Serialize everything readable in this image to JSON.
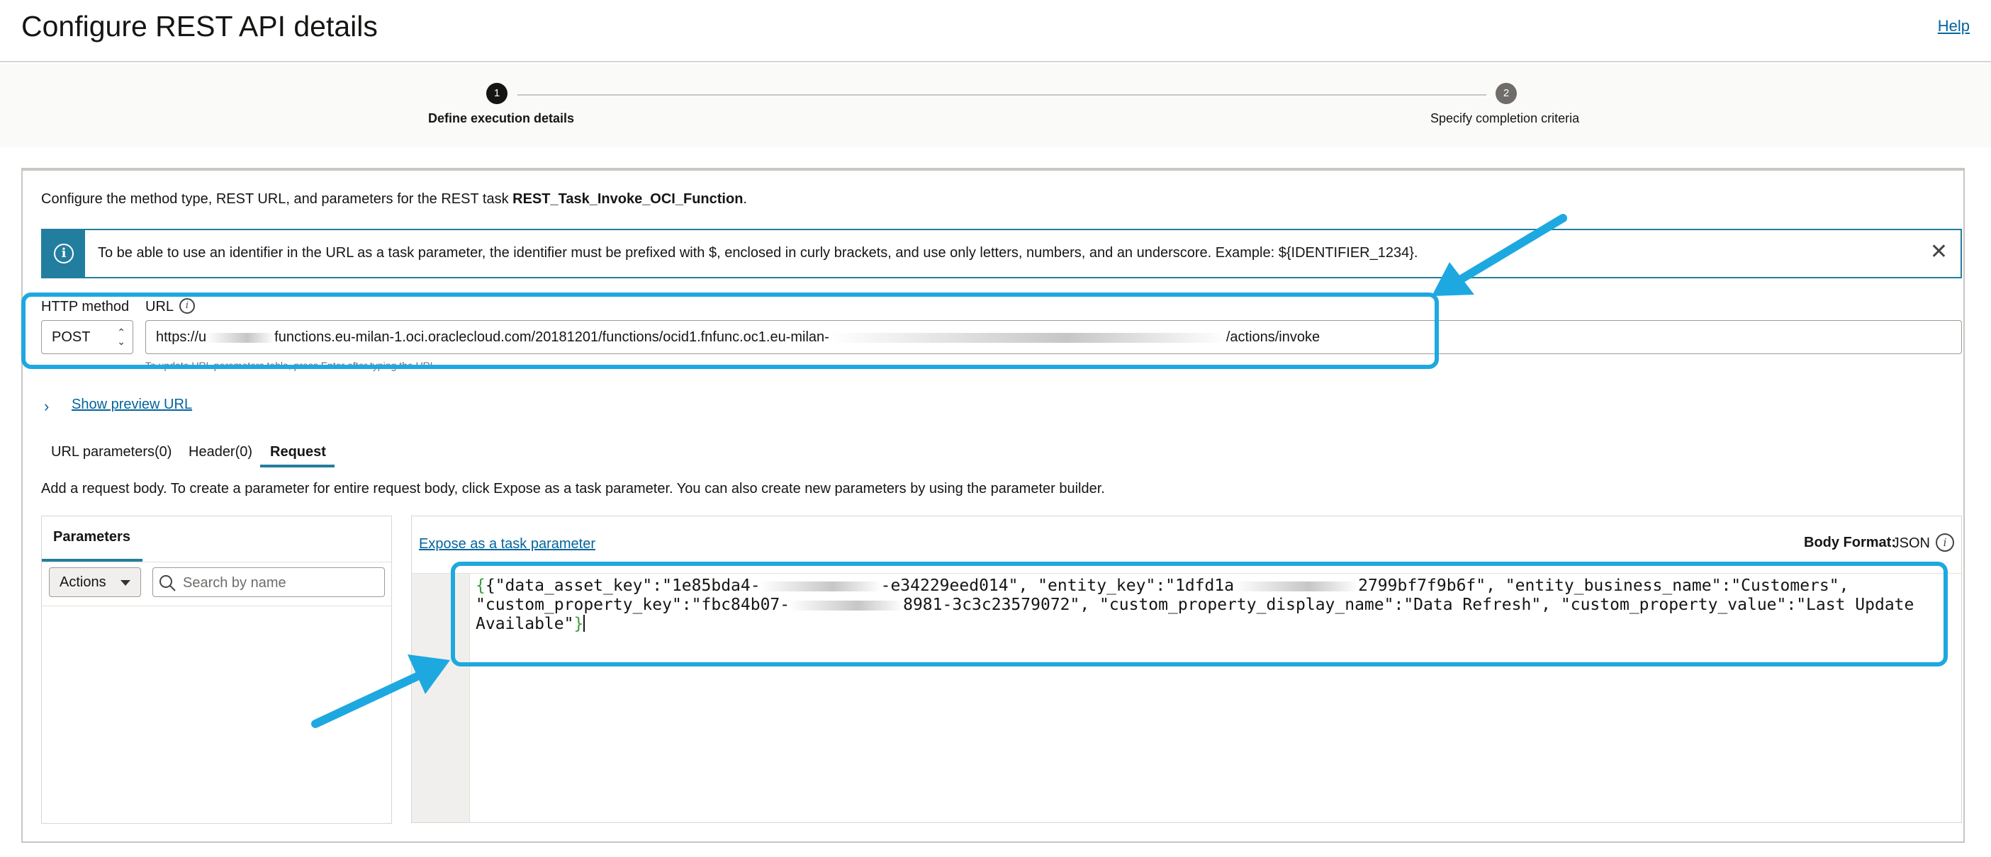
{
  "header": {
    "title": "Configure REST API details",
    "help_label": "Help"
  },
  "train": {
    "steps": [
      {
        "number": "1",
        "label": "Define execution details",
        "state": "active"
      },
      {
        "number": "2",
        "label": "Specify completion criteria",
        "state": "inactive"
      }
    ]
  },
  "intro": {
    "text": "Configure the method type, REST URL, and parameters for the REST task ",
    "task_name": "REST_Task_Invoke_OCI_Function",
    "suffix": "."
  },
  "info_banner": {
    "icon": "info-icon",
    "text": "To be able to use an identifier in the URL as a task parameter, the identifier must be prefixed with $, enclosed in curly brackets, and use only letters, numbers, and an underscore. Example: ${IDENTIFIER_1234}.",
    "close_icon": "close-icon"
  },
  "request_config": {
    "method_label": "HTTP method",
    "method_value": "POST",
    "url_label": "URL",
    "url_prefix": "https://u",
    "url_part1": "functions.eu-milan-1.oci.oraclecloud.com/20181201/functions/ocid1.fnfunc.oc1.eu-milan-",
    "url_suffix": "/actions/invoke",
    "url_helper": "To update URL parameters table, press Enter after typing the URL."
  },
  "preview": {
    "label": "Show preview URL"
  },
  "tabs": [
    {
      "label": "URL parameters(0)",
      "selected": false
    },
    {
      "label": "Header(0)",
      "selected": false
    },
    {
      "label": "Request",
      "selected": true
    }
  ],
  "request_description": "Add a request body. To create a parameter for entire request body, click Expose as a task parameter. You can also create new parameters by using the parameter builder.",
  "parameters_panel": {
    "title": "Parameters",
    "actions_label": "Actions",
    "search_placeholder": "Search by name"
  },
  "body_panel": {
    "expose_label": "Expose as a task parameter",
    "body_format_label": "Body Format:",
    "body_format_value": "JSON",
    "code_lines": [
      "{\"data_asset_key\":\"1e85bda4-",
      "-e34229eed014\", \"entity_key\":\"1dfd1a",
      "2799bf7f9b6f\", \"entity_business_name\":\"Customers\",",
      "\"custom_property_key\":\"fbc84b07-",
      "8981-3c3c23579072\", \"custom_property_display_name\":\"Data Refresh\", \"custom_property_value\":\"Last Update",
      "Available\""
    ]
  },
  "colors": {
    "accent": "#227e9e",
    "link": "#04659e",
    "annotation": "#1ea8e0",
    "json_brace": "#3a9e3a"
  }
}
